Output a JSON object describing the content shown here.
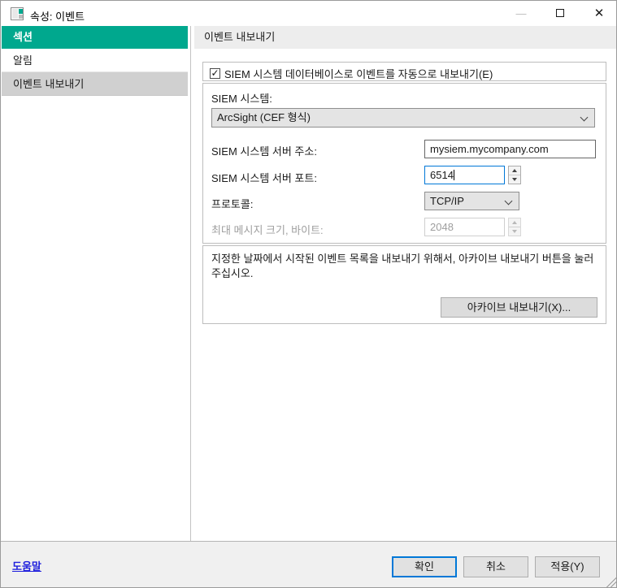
{
  "window": {
    "title": "속성: 이벤트",
    "glyphs": {
      "minimize": "—",
      "close": "✕",
      "check": "✓"
    }
  },
  "sidebar": {
    "header": "섹션",
    "items": [
      {
        "label": "알림",
        "selected": false
      },
      {
        "label": "이벤트 내보내기",
        "selected": true
      }
    ]
  },
  "main": {
    "header": "이벤트 내보내기",
    "auto_export": {
      "label": "SIEM 시스템 데이터베이스로 이벤트를 자동으로 내보내기(E)",
      "checked": true
    },
    "fields": {
      "siem_system": {
        "label": "SIEM 시스템:",
        "value": "ArcSight (CEF 형식)"
      },
      "server_address": {
        "label": "SIEM 시스템 서버 주소:",
        "value": "mysiem.mycompany.com"
      },
      "server_port": {
        "label": "SIEM 시스템 서버 포트:",
        "value": "6514",
        "focused": true
      },
      "protocol": {
        "label": "프로토콜:",
        "value": "TCP/IP"
      },
      "max_message_size": {
        "label": "최대 메시지 크기, 바이트:",
        "value": "2048",
        "disabled": true
      }
    },
    "archive": {
      "description": "지정한 날짜에서 시작된 이벤트 목록을 내보내기 위해서, 아카이브 내보내기 버튼을 눌러 주십시오.",
      "button_label": "아카이브 내보내기(X)..."
    }
  },
  "footer": {
    "help_label": "도움말",
    "ok_label": "확인",
    "cancel_label": "취소",
    "apply_label": "적용(Y)"
  },
  "colors": {
    "accent_teal": "#00a88e",
    "focus_blue": "#0078d7",
    "link_blue": "#2020dd",
    "selected_gray": "#d0d0d0"
  }
}
